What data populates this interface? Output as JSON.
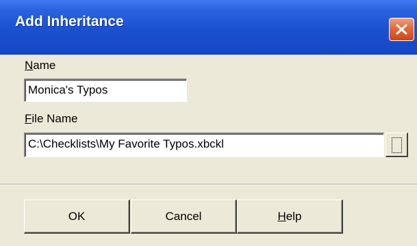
{
  "window": {
    "title": "Add Inheritance",
    "close_icon": "close-icon"
  },
  "fields": {
    "name": {
      "label_mnemonic": "N",
      "label_rest": "ame",
      "value": "Monica's Typos"
    },
    "file_name": {
      "label_mnemonic": "F",
      "label_rest": "ile Name",
      "value": "C:\\Checklists\\My Favorite Typos.xbckl",
      "browse_icon": "ellipsis-browse-icon"
    }
  },
  "buttons": {
    "ok": "OK",
    "cancel": "Cancel",
    "help_mnemonic": "H",
    "help_rest": "elp"
  },
  "colors": {
    "titlebar": "#1b50cf",
    "dialog_face": "#ece9d8",
    "close_button": "#e26a3a"
  }
}
